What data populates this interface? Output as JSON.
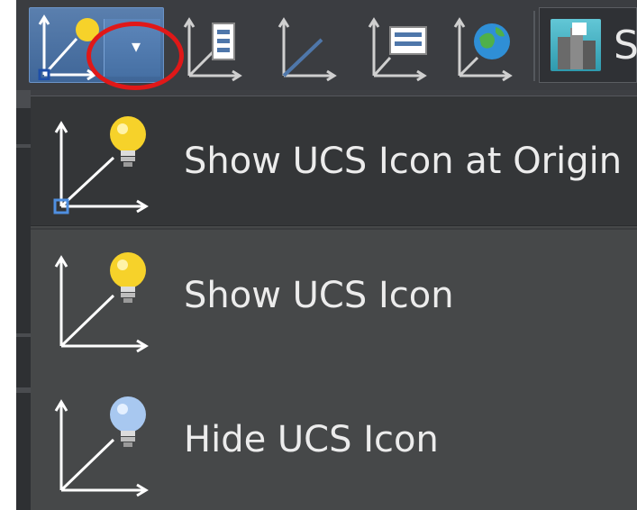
{
  "toolbar": {
    "buttons": [
      {
        "icon": "ucs-icon-dropdown",
        "dropdown_arrow": "▾"
      },
      {
        "icon": "ucs-icon-properties"
      },
      {
        "icon": "ucs-axis"
      },
      {
        "icon": "ucs-named-list"
      },
      {
        "icon": "ucs-world-globe"
      }
    ],
    "s_button": {
      "icon": "3d-city-icon",
      "label": "S"
    }
  },
  "menu": {
    "items": [
      {
        "label": "Show UCS Icon at Origin",
        "icon": "ucs-icon-at-origin-lightbulb-on",
        "highlighted": true
      },
      {
        "label": "Show UCS Icon",
        "icon": "ucs-icon-lightbulb-on",
        "highlighted": false
      },
      {
        "label": "Hide UCS Icon",
        "icon": "ucs-icon-lightbulb-off",
        "highlighted": false
      }
    ]
  },
  "colors": {
    "bulb_on": "#f6d22a",
    "bulb_off": "#a8c8f0",
    "highlight_circle": "#e01818",
    "accent_blue": "#4f77aa"
  }
}
